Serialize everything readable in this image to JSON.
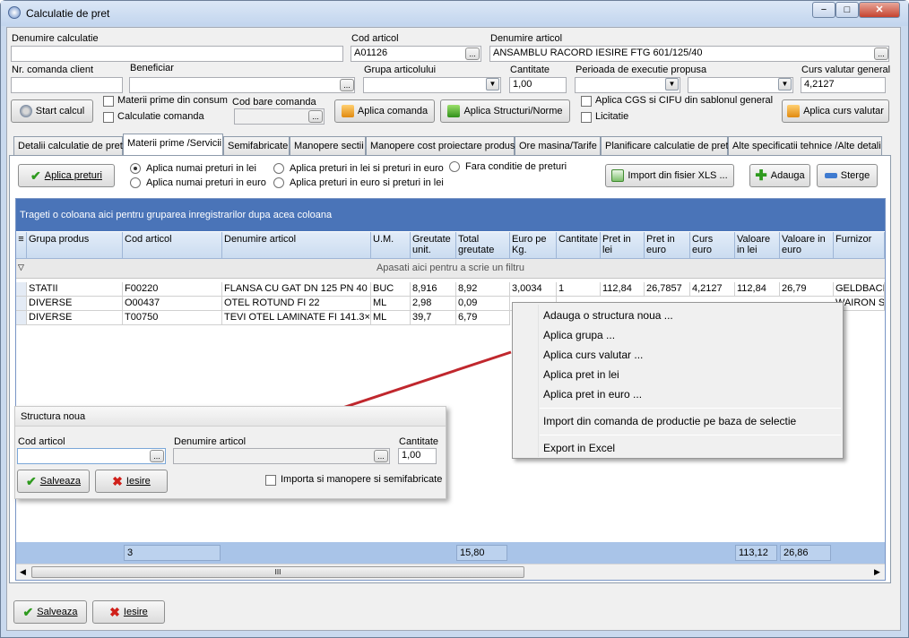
{
  "window": {
    "title": "Calculatie de pret",
    "min": "−",
    "max": "□",
    "close": "✕"
  },
  "header": {
    "denumire_calculatie_label": "Denumire calculatie",
    "denumire_calculatie_value": "",
    "cod_articol_label": "Cod articol",
    "cod_articol_value": "A01126",
    "denumire_articol_label": "Denumire articol",
    "denumire_articol_value": "ANSAMBLU RACORD IESIRE FTG 601/125/40",
    "nr_comanda_label": "Nr. comanda client",
    "nr_comanda_value": "",
    "beneficiar_label": "Beneficiar",
    "beneficiar_value": "",
    "grupa_label": "Grupa articolului",
    "grupa_value": "",
    "cantitate_label": "Cantitate",
    "cantitate_value": "1,00",
    "perioada_label": "Perioada de executie propusa",
    "perioada_value": "",
    "perioada_value2": "",
    "curs_label": "Curs valutar general",
    "curs_value": "4,2127",
    "start_calcul": "Start calcul",
    "materii_prime_consum": "Materii prime din consum",
    "calculatie_comanda": "Calculatie comanda",
    "cod_bare_label": "Cod bare comanda",
    "cod_bare_value": "",
    "aplica_comanda": "Aplica comanda",
    "aplica_structuri": "Aplica Structuri/Norme",
    "aplica_cgs": "Aplica CGS si CIFU din sablonul general",
    "licitatie": "Licitatie",
    "aplica_curs": "Aplica curs valutar",
    "ellipsis": "..."
  },
  "tabs": [
    "Detalii calculatie de pret",
    "Materii prime /Servicii",
    "Semifabricate",
    "Manopere sectii",
    "Manopere cost proiectare produs",
    "Ore masina/Tarife",
    "Planificare calculatie de pret",
    "Alte specificatii tehnice /Alte detalii"
  ],
  "toolbar": {
    "aplica_preturi": "Aplica preturi",
    "radio": [
      "Aplica numai preturi in lei",
      "Aplica numai preturi in euro",
      "Aplica preturi in lei si preturi in euro",
      "Aplica preturi in euro si preturi in lei",
      "Fara conditie de preturi"
    ],
    "import_xls": "Import din fisier XLS ...",
    "adauga": "Adauga",
    "sterge": "Sterge"
  },
  "grid": {
    "group_hint": "Trageti o coloana aici pentru gruparea inregistrarilor dupa acea coloana",
    "filter_hint": "Apasati aici pentru a scrie un filtru",
    "columns": [
      "Grupa produs",
      "Cod articol",
      "Denumire articol",
      "U.M.",
      "Greutate unit.",
      "Total greutate",
      "Euro pe Kg.",
      "Cantitate",
      "Pret in lei",
      "Pret in euro",
      "Curs euro",
      "Valoare in lei",
      "Valoare in euro",
      "Furnizor"
    ],
    "rows": [
      [
        "STATII",
        "F00220",
        "FLANSA CU GAT DN 125 PN 40",
        "BUC",
        "8,916",
        "8,92",
        "3,0034",
        "1",
        "112,84",
        "26,7857",
        "4,2127",
        "112,84",
        "26,79",
        "GELDBACH"
      ],
      [
        "DIVERSE",
        "O00437",
        "OTEL ROTUND FI 22",
        "ML",
        "2,98",
        "0,09",
        "",
        "",
        "",
        "",
        "",
        "",
        "",
        "WAIRON S"
      ],
      [
        "DIVERSE",
        "T00750",
        "TEVI OTEL LAMINATE FI 141.3×",
        "ML",
        "39,7",
        "6,79",
        "",
        "",
        "",
        "",
        "",
        "",
        "",
        ""
      ]
    ],
    "footer": {
      "count": "3",
      "total_greutate": "15,80",
      "valoare_lei": "113,12",
      "valoare_euro": "26,86"
    },
    "scroll_thumb": "III"
  },
  "context_menu": [
    "Adauga o structura noua ...",
    "Aplica grupa ...",
    "Aplica curs valutar ...",
    "Aplica pret in lei",
    "Aplica pret in euro ...",
    "Import din comanda de productie pe baza de selectie",
    "Export in Excel"
  ],
  "popup": {
    "title": "Structura noua",
    "cod_label": "Cod articol",
    "cod_value": "",
    "denumire_label": "Denumire articol",
    "denumire_value": "",
    "cantitate_label": "Cantitate",
    "cantitate_value": "1,00",
    "salveaza": "Salveaza",
    "iesire": "Iesire",
    "importa": "Importa si manopere si semifabricate"
  },
  "bottom": {
    "salveaza": "Salveaza",
    "iesire": "Iesire"
  },
  "colors": {
    "group_bar": "#4a74b8",
    "grid_header": "#cbdcf0",
    "footer": "#a9c4e8",
    "arrow": "#c0272d"
  }
}
